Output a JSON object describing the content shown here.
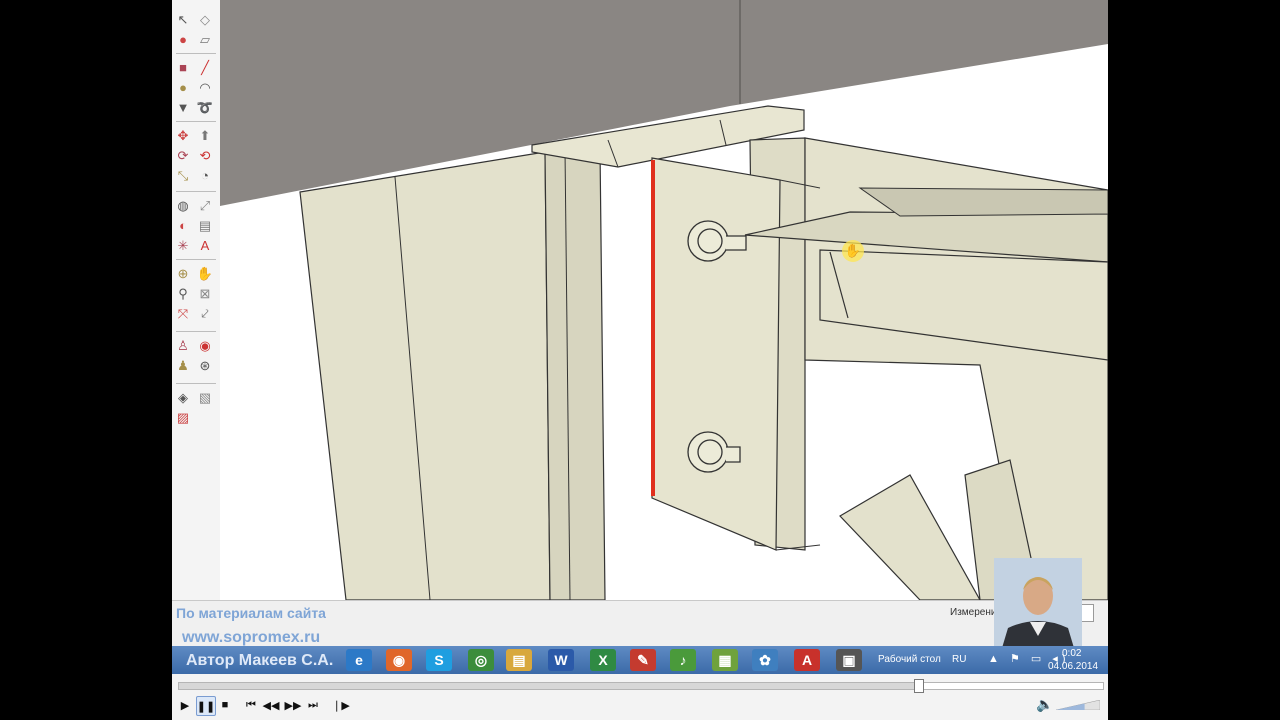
{
  "overlay": {
    "site_label": "По материалам сайта",
    "site_url": "www.sopromex.ru",
    "author": "Автор Макеев С.А."
  },
  "status": {
    "measure_label": "Измерения",
    "measure_value": ""
  },
  "toolbar": {
    "icons": [
      "select-icon",
      "eraser-icon",
      "paint-bucket-icon",
      "component-icon",
      "rectangle-icon",
      "pencil-icon",
      "circle-icon",
      "arc-icon",
      "polygon-icon",
      "freehand-icon",
      "move-icon",
      "push-pull-icon",
      "rotate-icon",
      "follow-me-icon",
      "scale-icon",
      "offset-icon",
      "tape-measure-icon",
      "dimension-icon",
      "protractor-icon",
      "text-icon",
      "axes-icon",
      "3d-text-icon",
      "orbit-icon",
      "pan-icon",
      "zoom-icon",
      "zoom-window-icon",
      "zoom-extents-icon",
      "previous-view-icon",
      "position-camera-icon",
      "look-around-icon",
      "walk-icon",
      "section-plane-icon",
      "sandbox-icon",
      "materials-icon",
      "styles-icon"
    ]
  },
  "taskbar": {
    "desktop_label": "Рабочий стол",
    "language": "RU",
    "time": "0:02",
    "date": "04.06.2014",
    "apps": [
      {
        "name": "ie-icon",
        "glyph": "e",
        "color": "#2c79c7"
      },
      {
        "name": "firefox-icon",
        "glyph": "◉",
        "color": "#e0662a"
      },
      {
        "name": "skype-icon",
        "glyph": "S",
        "color": "#1f9ee0"
      },
      {
        "name": "media-icon",
        "glyph": "◎",
        "color": "#3c8d3c"
      },
      {
        "name": "explorer-icon",
        "glyph": "▤",
        "color": "#d8a83d"
      },
      {
        "name": "word-icon",
        "glyph": "W",
        "color": "#2b5aa9"
      },
      {
        "name": "excel-icon",
        "glyph": "X",
        "color": "#2f8a43"
      },
      {
        "name": "sketchup-icon",
        "glyph": "✎",
        "color": "#c43b2f"
      },
      {
        "name": "lyre-icon",
        "glyph": "♪",
        "color": "#4a9a3b"
      },
      {
        "name": "notes-icon",
        "glyph": "▦",
        "color": "#6fa23d"
      },
      {
        "name": "paint-icon",
        "glyph": "✿",
        "color": "#3f7fbf"
      },
      {
        "name": "acrobat-icon",
        "glyph": "A",
        "color": "#c8312b"
      },
      {
        "name": "camera-icon",
        "glyph": "▣",
        "color": "#555555"
      }
    ]
  },
  "player": {
    "progress_fraction": 0.8,
    "volume_fraction": 0.65
  },
  "colors": {
    "steel": "#e6e4cf",
    "concrete": "#8a8683",
    "taskbar": "#4a78b6",
    "edge_highlight": "#e0301e"
  }
}
